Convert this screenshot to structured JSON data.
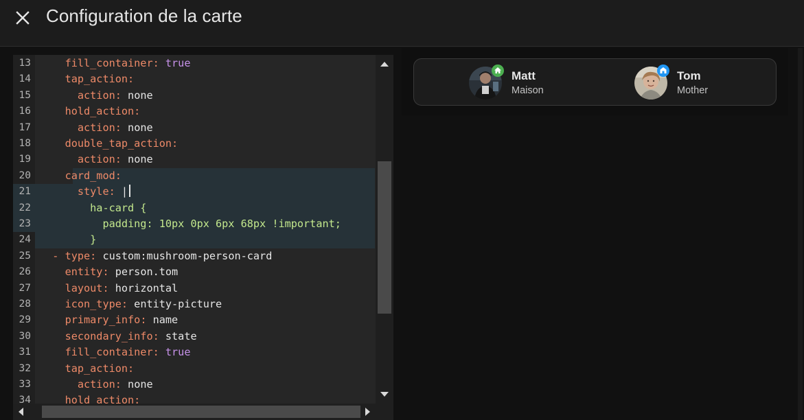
{
  "header": {
    "title": "Configuration de la carte",
    "close_icon": "close-icon"
  },
  "editor": {
    "lines": [
      {
        "n": "13",
        "indent": "    ",
        "key": "fill_container",
        "sep": ": ",
        "val": "true",
        "type": "bool"
      },
      {
        "n": "14",
        "indent": "    ",
        "key": "tap_action",
        "sep": ":",
        "val": "",
        "type": "text"
      },
      {
        "n": "15",
        "indent": "      ",
        "key": "action",
        "sep": ": ",
        "val": "none",
        "type": "text"
      },
      {
        "n": "16",
        "indent": "    ",
        "key": "hold_action",
        "sep": ":",
        "val": "",
        "type": "text"
      },
      {
        "n": "17",
        "indent": "      ",
        "key": "action",
        "sep": ": ",
        "val": "none",
        "type": "text"
      },
      {
        "n": "18",
        "indent": "    ",
        "key": "double_tap_action",
        "sep": ":",
        "val": "",
        "type": "text"
      },
      {
        "n": "19",
        "indent": "      ",
        "key": "action",
        "sep": ": ",
        "val": "none",
        "type": "text"
      },
      {
        "n": "20",
        "indent": "    ",
        "key": "card_mod",
        "sep": ":",
        "val": "",
        "type": "text"
      },
      {
        "n": "21",
        "indent": "      ",
        "key": "style",
        "sep": ": ",
        "val": "|",
        "type": "text"
      },
      {
        "n": "22",
        "indent": "        ",
        "key": "",
        "sep": "",
        "val": "ha-card {",
        "type": "str"
      },
      {
        "n": "23",
        "indent": "          ",
        "key": "",
        "sep": "",
        "val": "padding: 10px 0px 6px 68px !important;",
        "type": "str"
      },
      {
        "n": "24",
        "indent": "        ",
        "key": "",
        "sep": "",
        "val": "}",
        "type": "str"
      },
      {
        "n": "25",
        "indent": "  - ",
        "key": "type",
        "sep": ": ",
        "val": "custom:mushroom-person-card",
        "type": "text"
      },
      {
        "n": "26",
        "indent": "    ",
        "key": "entity",
        "sep": ": ",
        "val": "person.tom",
        "type": "text"
      },
      {
        "n": "27",
        "indent": "    ",
        "key": "layout",
        "sep": ": ",
        "val": "horizontal",
        "type": "text"
      },
      {
        "n": "28",
        "indent": "    ",
        "key": "icon_type",
        "sep": ": ",
        "val": "entity-picture",
        "type": "text"
      },
      {
        "n": "29",
        "indent": "    ",
        "key": "primary_info",
        "sep": ": ",
        "val": "name",
        "type": "text"
      },
      {
        "n": "30",
        "indent": "    ",
        "key": "secondary_info",
        "sep": ": ",
        "val": "state",
        "type": "text"
      },
      {
        "n": "31",
        "indent": "    ",
        "key": "fill_container",
        "sep": ": ",
        "val": "true",
        "type": "bool"
      },
      {
        "n": "32",
        "indent": "    ",
        "key": "tap_action",
        "sep": ":",
        "val": "",
        "type": "text"
      },
      {
        "n": "33",
        "indent": "      ",
        "key": "action",
        "sep": ": ",
        "val": "none",
        "type": "text"
      },
      {
        "n": "34",
        "indent": "    ",
        "key": "hold_action",
        "sep": ":",
        "val": "",
        "type": "text"
      }
    ]
  },
  "preview": {
    "persons": [
      {
        "name": "Matt",
        "state": "Maison",
        "badge_icon": "home-icon",
        "badge_color": "#4caf50"
      },
      {
        "name": "Tom",
        "state": "Mother",
        "badge_icon": "building-icon",
        "badge_color": "#2196f3"
      }
    ]
  }
}
